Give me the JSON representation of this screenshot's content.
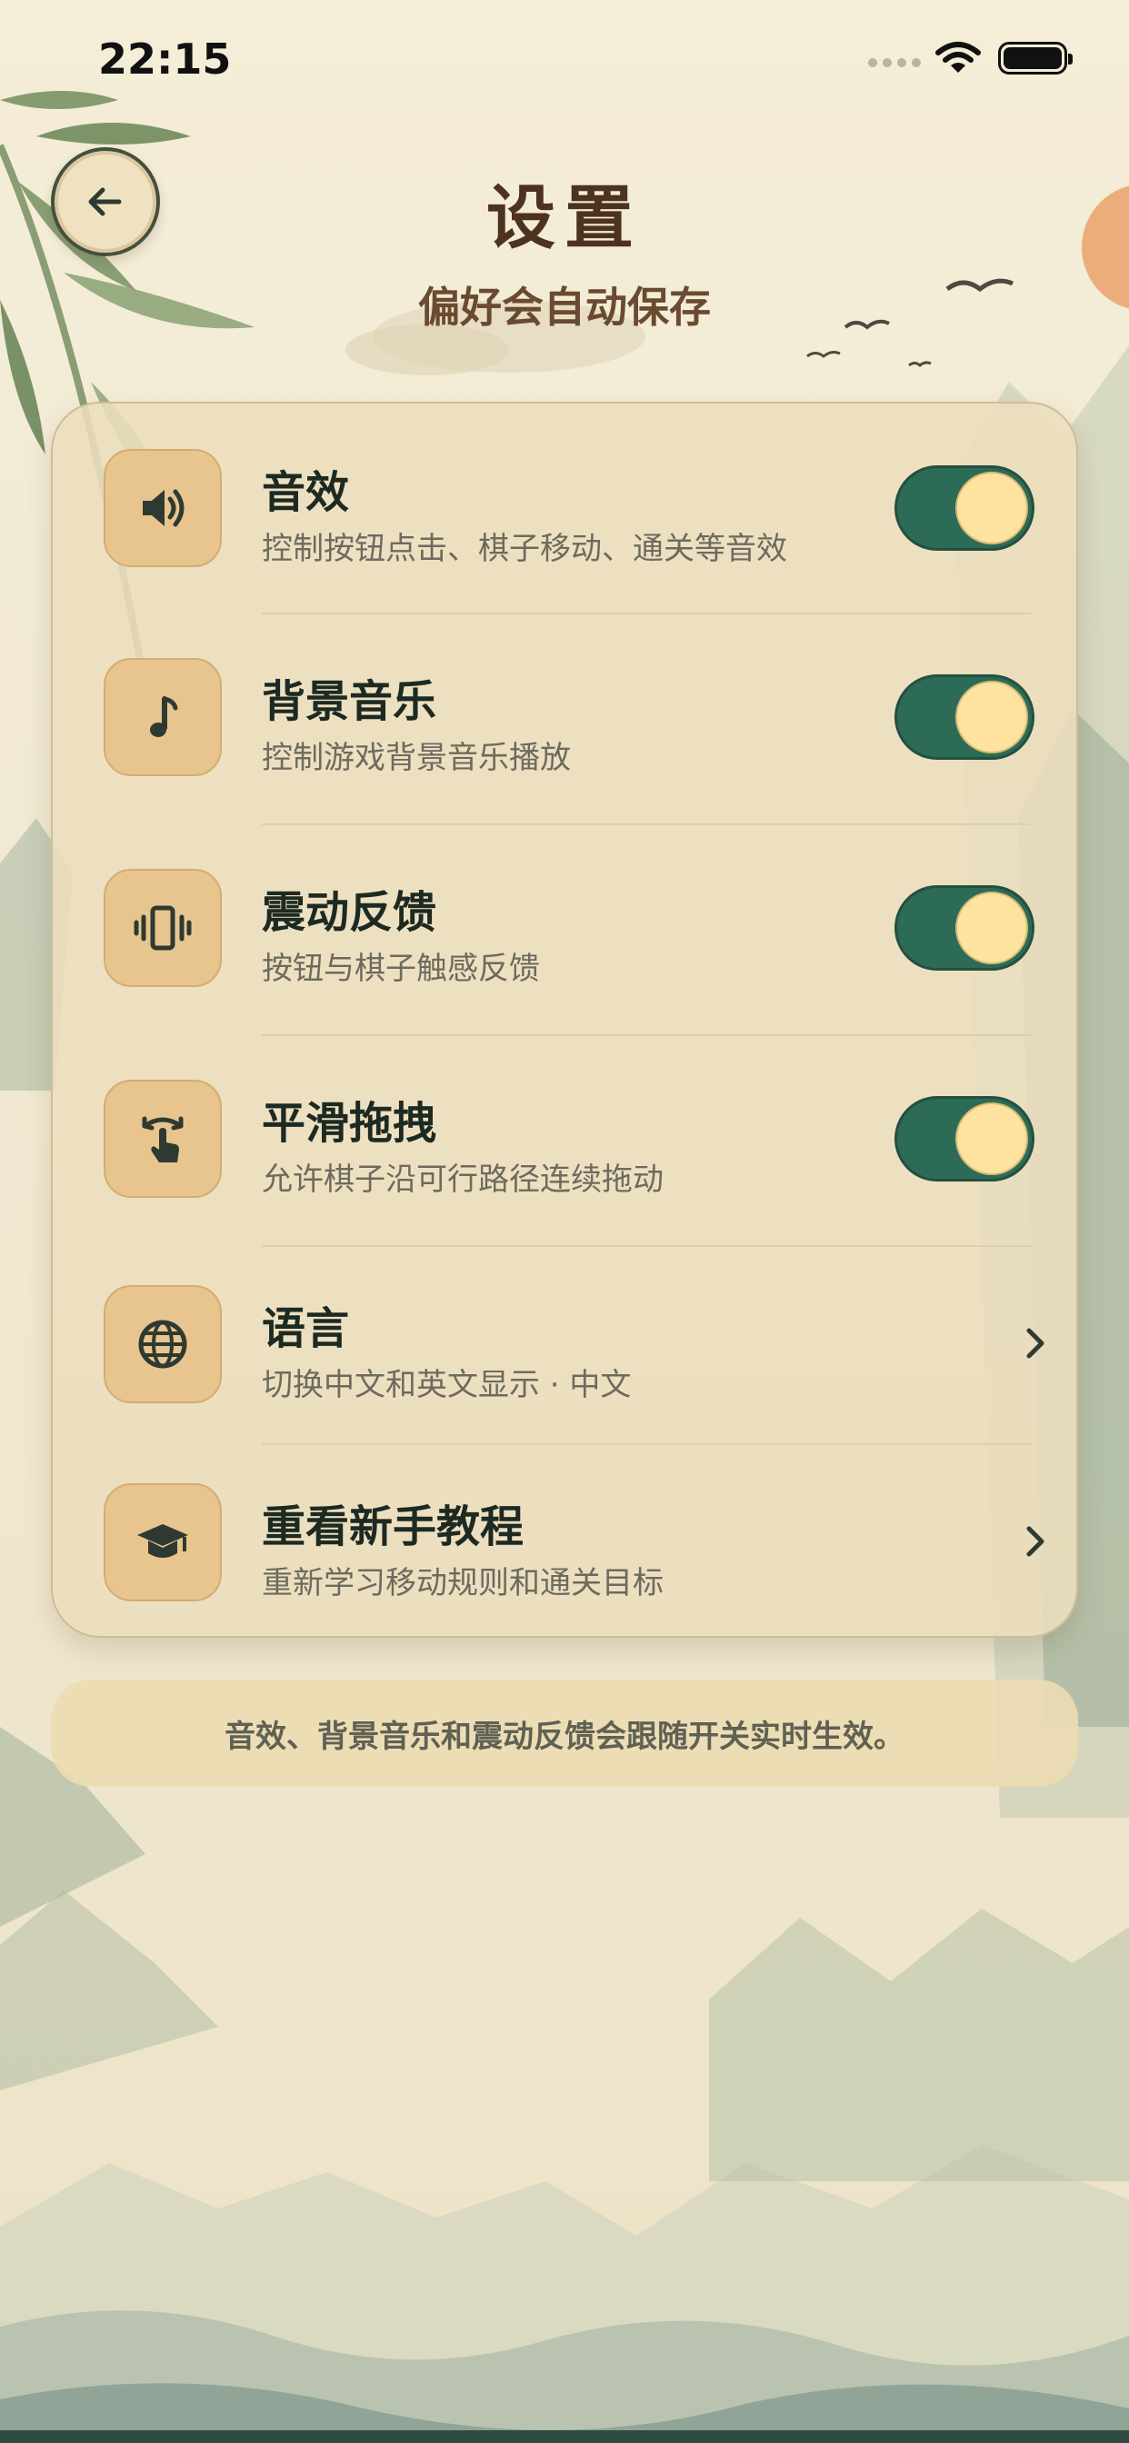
{
  "status_bar": {
    "time": "22:15"
  },
  "header": {
    "title": "设置",
    "subtitle": "偏好会自动保存"
  },
  "settings": {
    "items": [
      {
        "title": "音效",
        "description": "控制按钮点击、棋子移动、通关等音效",
        "icon": "speaker-icon",
        "control": "toggle",
        "enabled": true
      },
      {
        "title": "背景音乐",
        "description": "控制游戏背景音乐播放",
        "icon": "music-note-icon",
        "control": "toggle",
        "enabled": true
      },
      {
        "title": "震动反馈",
        "description": "按钮与棋子触感反馈",
        "icon": "vibration-icon",
        "control": "toggle",
        "enabled": true
      },
      {
        "title": "平滑拖拽",
        "description": "允许棋子沿可行路径连续拖动",
        "icon": "swipe-hand-icon",
        "control": "toggle",
        "enabled": true
      },
      {
        "title": "语言",
        "description": "切换中文和英文显示 · 中文",
        "icon": "globe-icon",
        "control": "chevron"
      },
      {
        "title": "重看新手教程",
        "description": "重新学习移动规则和通关目标",
        "icon": "graduation-cap-icon",
        "control": "chevron"
      }
    ]
  },
  "notice": {
    "text": "音效、背景音乐和震动反馈会跟随开关实时生效。"
  },
  "colors": {
    "background": "#f1e9d3",
    "card": "#ecdebe",
    "toggle_on": "#2c6b55",
    "toggle_knob": "#fde2a0",
    "icon_tile": "#e8c58e",
    "title_brown": "#4d3220"
  }
}
